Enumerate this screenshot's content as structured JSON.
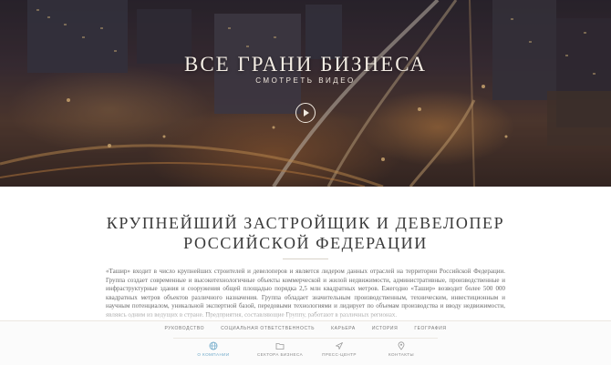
{
  "hero": {
    "title": "ВСЕ ГРАНИ БИЗНЕСА",
    "video_link": "СМОТРЕТЬ ВИДЕО",
    "play_icon": "play-icon"
  },
  "main": {
    "headline_line1": "КРУПНЕЙШИЙ ЗАСТРОЙЩИК И ДЕВЕЛОПЕР",
    "headline_line2": "РОССИЙСКОЙ ФЕДЕРАЦИИ",
    "body": "«Ташир» входит в число крупнейших строителей и девелоперов и является лидером данных отраслей на территории Российской Федерации. Группа создает современные и высокотехнологичные объекты коммерческой и жилой недвижимости, административные, производственные и инфраструктурные здания и сооружения общей площадью порядка 2,5 млн квадратных метров. Ежегодно «Ташир» возводит более 500 000 квадратных метров объектов различного назначения. Группа обладает значительным производственным, техническим, инвестиционным и научным потенциалом, уникальной экспертной базой, передовыми технологиями и лидирует по объемам производства и вводу недвижимости, являясь одним из ведущих в стране. Предприятия, составляющие Группу, работают в различных регионах."
  },
  "subnav": {
    "items": [
      "РУКОВОДСТВО",
      "СОЦИАЛЬНАЯ ОТВЕТСТВЕННОСТЬ",
      "КАРЬЕРА",
      "ИСТОРИЯ",
      "ГЕОГРАФИЯ"
    ]
  },
  "mainnav": {
    "items": [
      {
        "label": "О КОМПАНИИ",
        "icon": "globe-icon"
      },
      {
        "label": "СЕКТОРА БИЗНЕСА",
        "icon": "folder-icon"
      },
      {
        "label": "ПРЕСС-ЦЕНТР",
        "icon": "send-icon"
      },
      {
        "label": "КОНТАКТЫ",
        "icon": "map-pin-icon"
      }
    ]
  },
  "colors": {
    "accent": "#6fa9c9",
    "headline": "#3a3a3a",
    "nav_text": "#8a8a8a"
  }
}
